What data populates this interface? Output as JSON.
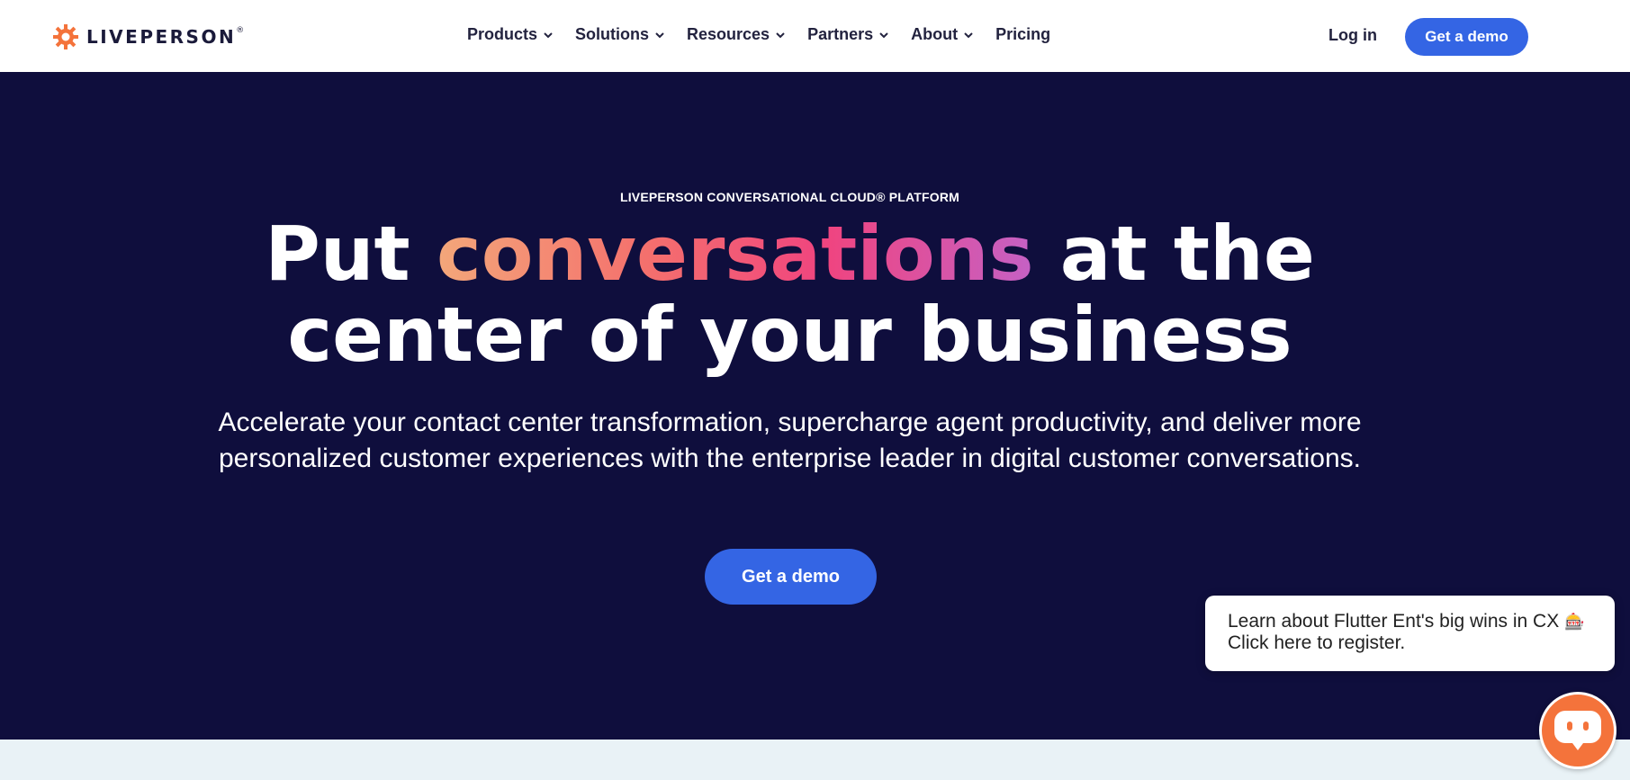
{
  "header": {
    "logo_text": "LIVEPERSON",
    "logo_mark": "®",
    "nav": [
      {
        "label": "Products",
        "has_dropdown": true
      },
      {
        "label": "Solutions",
        "has_dropdown": true
      },
      {
        "label": "Resources",
        "has_dropdown": true
      },
      {
        "label": "Partners",
        "has_dropdown": true
      },
      {
        "label": "About",
        "has_dropdown": true
      },
      {
        "label": "Pricing",
        "has_dropdown": false
      }
    ],
    "login_label": "Log in",
    "demo_label": "Get a demo"
  },
  "hero": {
    "eyebrow": "LIVEPERSON CONVERSATIONAL CLOUD® PLATFORM",
    "headline_part1": "Put ",
    "headline_highlight": "conversations",
    "headline_part2": " at the",
    "headline_line2": "center of your business",
    "subhead": "Accelerate your contact center transformation, supercharge agent productivity, and deliver more personalized customer experiences with the enterprise leader in digital customer conversations.",
    "cta_label": "Get a demo"
  },
  "chat_popup": {
    "line1": "Learn about Flutter Ent's big wins in CX",
    "line1_icon": "slot-machine-icon",
    "line2": "Click here to register."
  },
  "chat_launcher": {
    "icon": "chat-bot-icon"
  },
  "colors": {
    "brand_orange": "#f4733b",
    "accent_blue": "#3465e4",
    "hero_bg": "#0f0e3d",
    "band_bg": "#e9f2f6"
  }
}
